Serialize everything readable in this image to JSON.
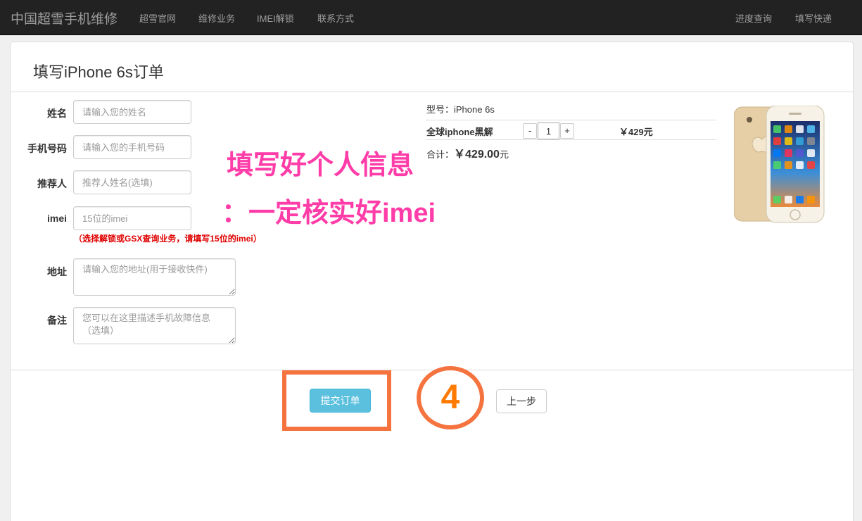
{
  "navbar": {
    "brand": "中国超雪手机维修",
    "links": [
      "超雪官网",
      "维修业务",
      "IMEI解锁",
      "联系方式"
    ],
    "right_links": [
      "进度查询",
      "填写快递"
    ]
  },
  "panel": {
    "title": "填写iPhone 6s订单"
  },
  "form": {
    "name": {
      "label": "姓名",
      "placeholder": "请输入您的姓名"
    },
    "phone": {
      "label": "手机号码",
      "placeholder": "请输入您的手机号码"
    },
    "referrer": {
      "label": "推荐人",
      "placeholder": "推荐人姓名(选填)"
    },
    "imei": {
      "label": "imei",
      "placeholder": "15位的imei"
    },
    "imei_hint": "（选择解锁或GSX查询业务，请填写15位的imei）",
    "address": {
      "label": "地址",
      "placeholder": "请输入您的地址(用于接收快件)"
    },
    "remark": {
      "label": "备注",
      "placeholder": "您可以在这里描述手机故障信息（选填）"
    }
  },
  "order": {
    "model": "型号：iPhone 6s",
    "service": "全球iphone黑解",
    "qty_minus": "-",
    "qty_value": "1",
    "qty_plus": "+",
    "price": "￥429元",
    "total_label": "合计：",
    "total_value": "￥429.00",
    "total_unit": "元"
  },
  "annotations": {
    "line1": "填写好个人信息",
    "line2": "：一定核实好imei",
    "step": "4",
    "color_text": "#ff3ca8",
    "color_frame": "#f5733f"
  },
  "buttons": {
    "submit": "提交订单",
    "back": "上一步"
  }
}
